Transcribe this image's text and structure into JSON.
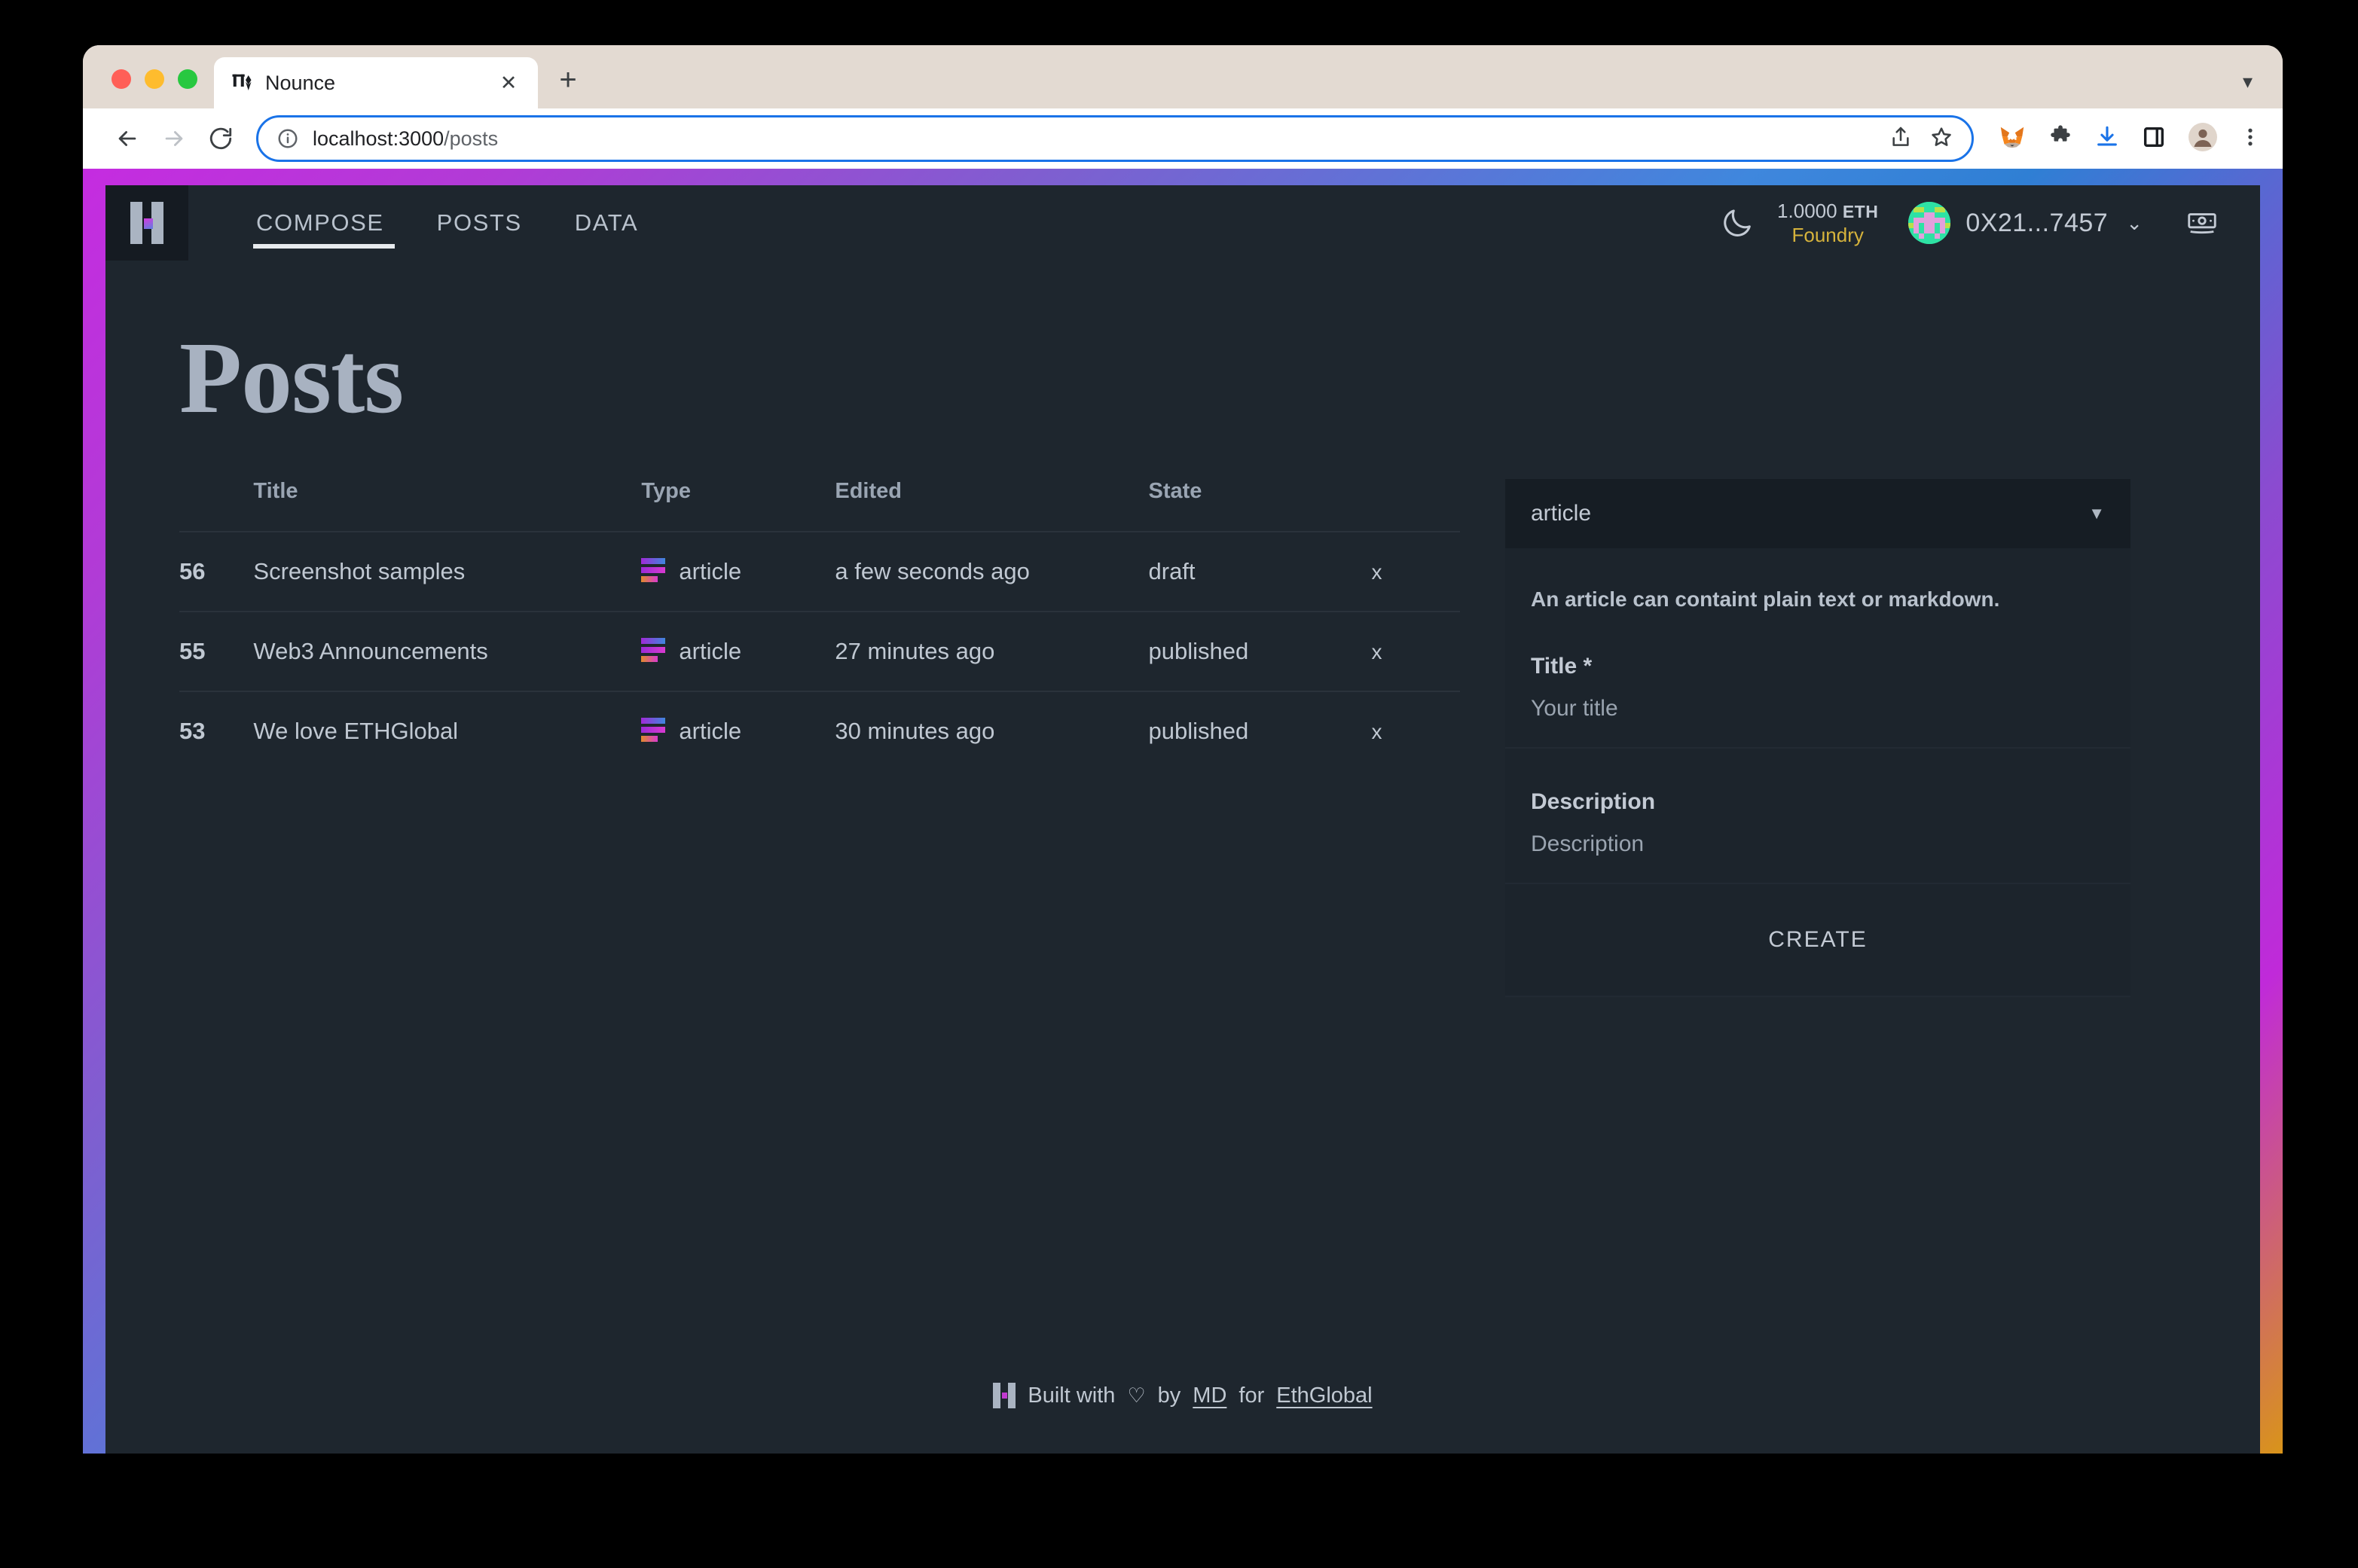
{
  "browser": {
    "tab": {
      "title": "Nounce",
      "favicon_icon": "nounce-favicon",
      "close_icon": "close-icon"
    },
    "new_tab_icon": "plus-icon",
    "window_caret_icon": "chevron-down-icon",
    "back_icon": "back-arrow-icon",
    "forward_icon": "forward-arrow-icon",
    "reload_icon": "reload-icon",
    "url_info_icon": "info-circle-icon",
    "url": "localhost:3000/posts",
    "url_host": "localhost:3000",
    "url_path": "/posts",
    "share_icon": "share-icon",
    "bookmark_icon": "star-icon",
    "extensions": [
      "metamask-fox-icon",
      "puzzle-extensions-icon",
      "download-icon",
      "side-panel-icon",
      "profile-avatar-icon",
      "three-dot-menu-icon"
    ]
  },
  "app": {
    "logo_icon": "nounce-logo-icon",
    "nav": [
      {
        "label": "COMPOSE",
        "active": true
      },
      {
        "label": "POSTS",
        "active": false
      },
      {
        "label": "DATA",
        "active": false
      }
    ],
    "theme_toggle_icon": "moon-icon",
    "wallet": {
      "balance": "1.0000",
      "balance_unit": "ETH",
      "network": "Foundry",
      "avatar_icon": "blockie-avatar",
      "address": "0X21...7457",
      "caret_icon": "chevron-down-icon"
    },
    "faucet_icon": "banknote-icon"
  },
  "page": {
    "title": "Posts"
  },
  "table": {
    "columns": [
      "Title",
      "Type",
      "Edited",
      "State"
    ],
    "rows": [
      {
        "id": "56",
        "title": "Screenshot samples",
        "type": "article",
        "edited": "a few seconds ago",
        "state": "draft",
        "delete": "x"
      },
      {
        "id": "55",
        "title": "Web3 Announcements",
        "type": "article",
        "edited": "27 minutes ago",
        "state": "published",
        "delete": "x"
      },
      {
        "id": "53",
        "title": "We love ETHGlobal",
        "type": "article",
        "edited": "30 minutes ago",
        "state": "published",
        "delete": "x"
      }
    ]
  },
  "form": {
    "type_select": {
      "value": "article",
      "caret_icon": "caret-down-icon"
    },
    "hint": "An article can containt plain text or markdown.",
    "title_label": "Title *",
    "title_placeholder": "Your title",
    "description_label": "Description",
    "description_placeholder": "Description",
    "submit_label": "CREATE"
  },
  "footer": {
    "logo_icon": "nounce-logo-icon",
    "built_with": "Built with",
    "heart_icon": "heart-icon",
    "by": "by",
    "author": "MD",
    "for": "for",
    "org": "EthGlobal"
  },
  "colors": {
    "accent_magenta": "#c52ce0",
    "accent_blue": "#2f7fd4",
    "accent_orange": "#d9941a",
    "network_yellow": "#d6b33c",
    "app_bg": "#1e262e",
    "panel_bg": "#1c242c"
  }
}
